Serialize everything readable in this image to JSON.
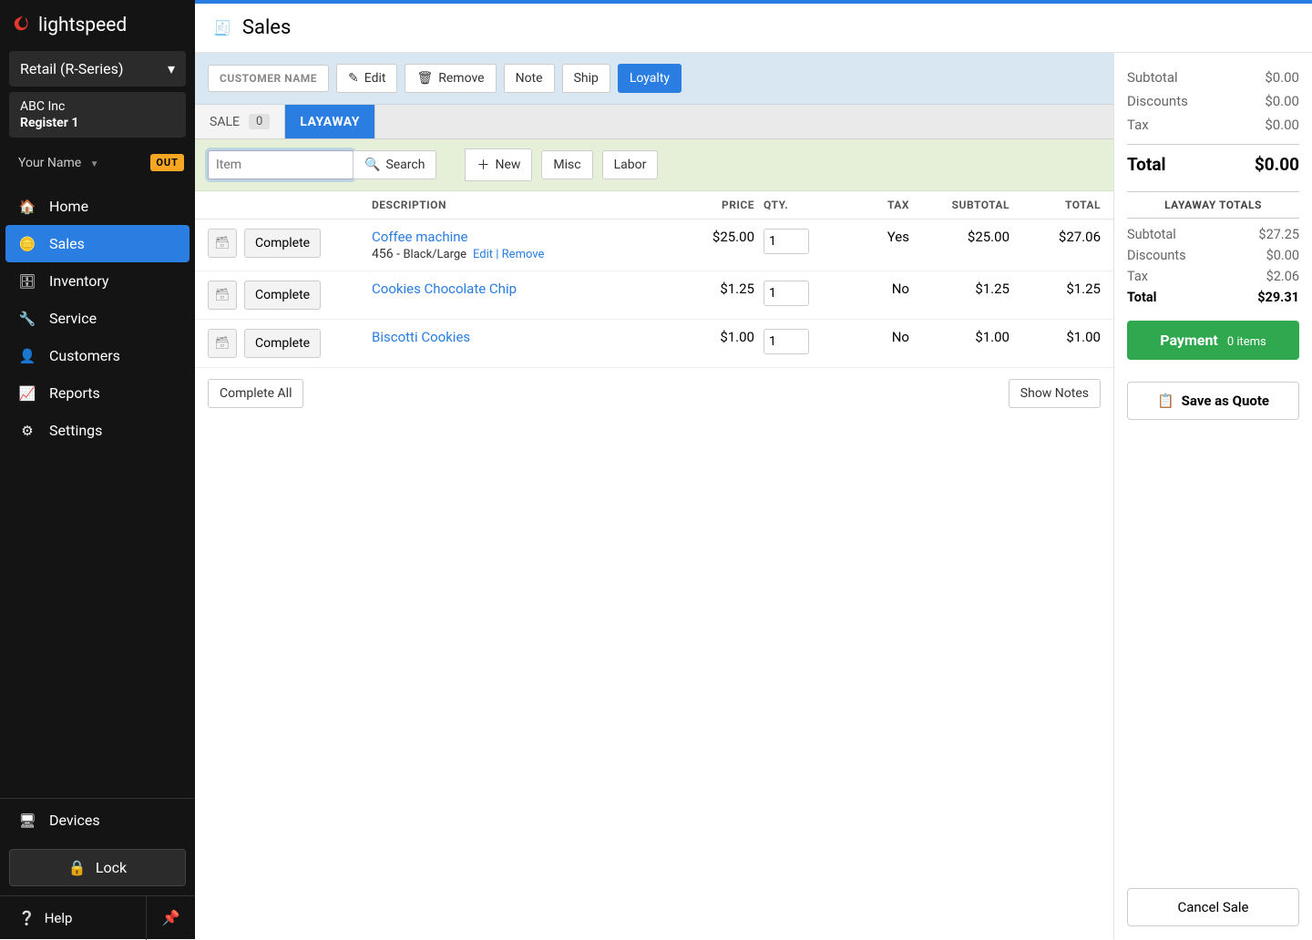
{
  "brand": "lightspeed",
  "series": "Retail (R-Series)",
  "company": "ABC Inc",
  "register": "Register 1",
  "user": "Your Name",
  "out_badge": "OUT",
  "nav": {
    "home": "Home",
    "sales": "Sales",
    "inventory": "Inventory",
    "service": "Service",
    "customers": "Customers",
    "reports": "Reports",
    "settings": "Settings",
    "devices": "Devices",
    "lock": "Lock",
    "help": "Help"
  },
  "page_title": "Sales",
  "toolbar": {
    "customer_name": "CUSTOMER NAME",
    "edit": "Edit",
    "remove": "Remove",
    "note": "Note",
    "ship": "Ship",
    "loyalty": "Loyalty"
  },
  "tabs": {
    "sale": "SALE",
    "sale_count": "0",
    "layaway": "LAYAWAY"
  },
  "search": {
    "placeholder": "Item",
    "search": "Search",
    "new": "New",
    "misc": "Misc",
    "labor": "Labor"
  },
  "columns": {
    "desc": "DESCRIPTION",
    "price": "PRICE",
    "qty": "QTY.",
    "tax": "TAX",
    "subtotal": "SUBTOTAL",
    "total": "TOTAL"
  },
  "line_actions": {
    "complete": "Complete",
    "edit": "Edit",
    "remove": "Remove",
    "sep": " | "
  },
  "items": [
    {
      "name": "Coffee machine",
      "sku": "456",
      "options": "Black/Large",
      "price": "$25.00",
      "qty": "1",
      "tax": "Yes",
      "subtotal": "$25.00",
      "total": "$27.06"
    },
    {
      "name": "Cookies Chocolate Chip",
      "sku": "",
      "options": "",
      "price": "$1.25",
      "qty": "1",
      "tax": "No",
      "subtotal": "$1.25",
      "total": "$1.25"
    },
    {
      "name": "Biscotti Cookies",
      "sku": "",
      "options": "",
      "price": "$1.00",
      "qty": "1",
      "tax": "No",
      "subtotal": "$1.00",
      "total": "$1.00"
    }
  ],
  "footer": {
    "complete_all": "Complete All",
    "show_notes": "Show Notes"
  },
  "summary": {
    "subtotal_label": "Subtotal",
    "subtotal": "$0.00",
    "discounts_label": "Discounts",
    "discounts": "$0.00",
    "tax_label": "Tax",
    "tax": "$0.00",
    "total_label": "Total",
    "total": "$0.00"
  },
  "layaway": {
    "heading": "LAYAWAY TOTALS",
    "subtotal_label": "Subtotal",
    "subtotal": "$27.25",
    "discounts_label": "Discounts",
    "discounts": "$0.00",
    "tax_label": "Tax",
    "tax": "$2.06",
    "total_label": "Total",
    "total": "$29.31"
  },
  "actions": {
    "payment": "Payment",
    "payment_sub": "0 items",
    "save_quote": "Save as Quote",
    "cancel": "Cancel Sale"
  }
}
